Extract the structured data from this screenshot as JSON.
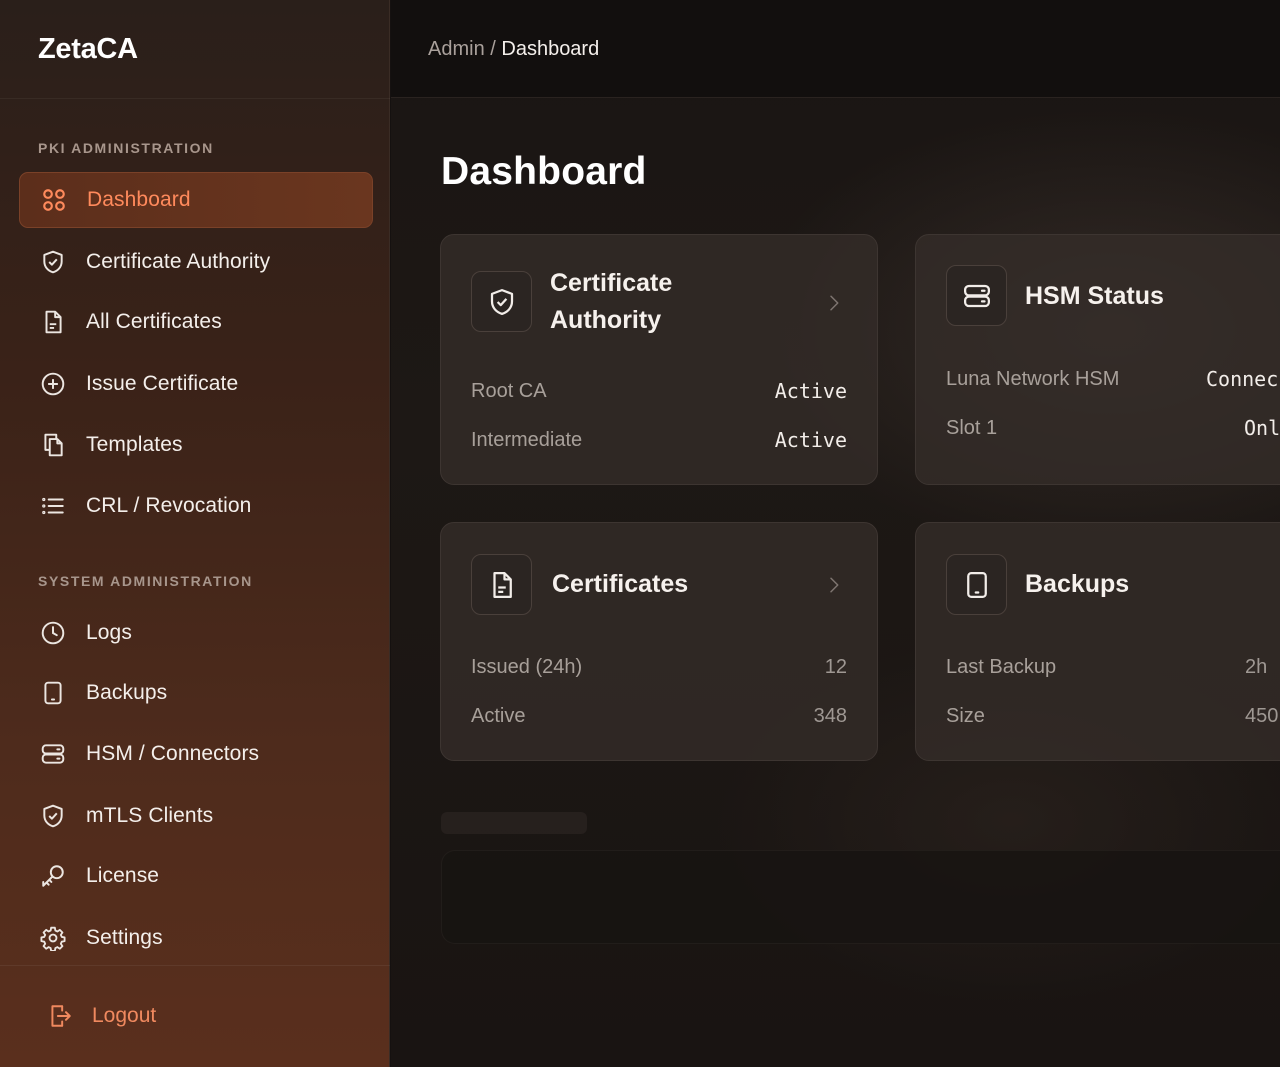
{
  "brand": {
    "name": "ZetaCA"
  },
  "breadcrumb": {
    "parent": "Admin",
    "separator": " / ",
    "current": "Dashboard"
  },
  "sidebar": {
    "sections": [
      {
        "label": "PKI ADMINISTRATION"
      },
      {
        "label": "SYSTEM ADMINISTRATION"
      }
    ],
    "items": [
      {
        "label": "Dashboard",
        "icon": "grid-icon",
        "active": true
      },
      {
        "label": "Certificate Authority",
        "icon": "shield-check-icon"
      },
      {
        "label": "All Certificates",
        "icon": "document-icon"
      },
      {
        "label": "Issue Certificate",
        "icon": "plus-circle-icon"
      },
      {
        "label": "Templates",
        "icon": "copy-icon"
      },
      {
        "label": "CRL / Revocation",
        "icon": "list-icon"
      },
      {
        "label": "Logs",
        "icon": "clock-icon"
      },
      {
        "label": "Backups",
        "icon": "tablet-icon"
      },
      {
        "label": "HSM / Connectors",
        "icon": "server-icon"
      },
      {
        "label": "mTLS Clients",
        "icon": "shield-check-icon"
      },
      {
        "label": "License",
        "icon": "key-icon"
      },
      {
        "label": "Settings",
        "icon": "gear-icon"
      }
    ],
    "logout": {
      "label": "Logout",
      "icon": "logout-icon"
    }
  },
  "page": {
    "title": "Dashboard"
  },
  "cards": {
    "ca": {
      "title_line1": "Certificate",
      "title_line2": "Authority",
      "icon": "shield-check-icon",
      "rows": [
        {
          "key": "Root CA",
          "value": "Active"
        },
        {
          "key": "Intermediate",
          "value": "Active"
        }
      ]
    },
    "hsm": {
      "title": "HSM Status",
      "icon": "server-icon",
      "rows": [
        {
          "key": "Luna Network HSM",
          "value": "Connec"
        },
        {
          "key": "Slot 1",
          "value": "Onl"
        }
      ]
    },
    "certs": {
      "title": "Certificates",
      "icon": "document-icon",
      "rows": [
        {
          "key": "Issued (24h)",
          "value": "12"
        },
        {
          "key": "Active",
          "value": "348"
        }
      ]
    },
    "backups": {
      "title": "Backups",
      "icon": "tablet-icon",
      "rows": [
        {
          "key": "Last Backup",
          "value": "2h"
        },
        {
          "key": "Size",
          "value": "450"
        }
      ]
    }
  },
  "colors": {
    "accent": "#ff8a5c",
    "logout": "#f0895f",
    "card_bg": "#342d29",
    "sidebar_top": "#2a1f1a",
    "sidebar_bottom": "#5a2f1d"
  }
}
